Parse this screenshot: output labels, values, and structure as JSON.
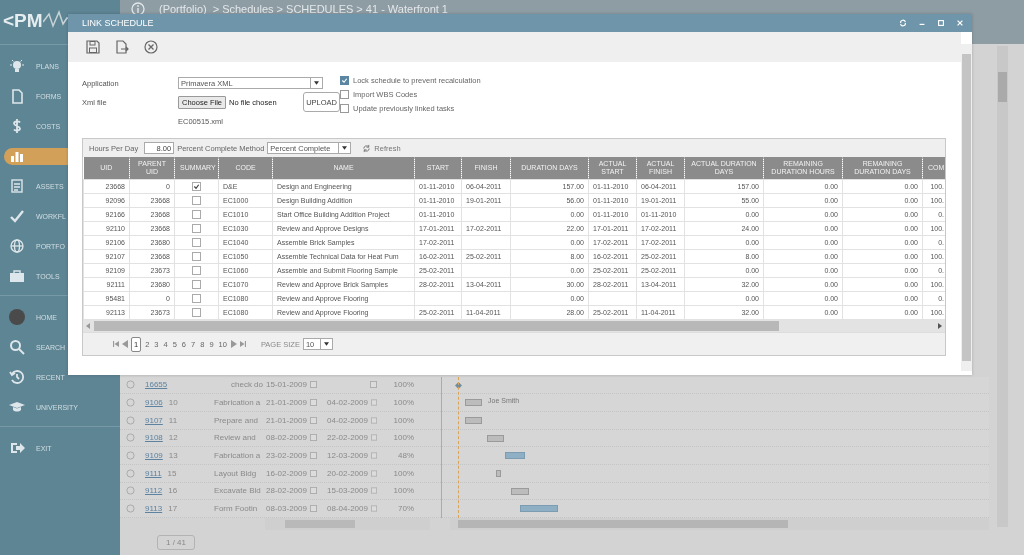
{
  "logo": {
    "text": "<PM"
  },
  "breadcrumb": {
    "link": "(Portfolio)",
    "path": "> Schedules > SCHEDULES > 41 - Waterfront 1"
  },
  "sidebar": {
    "groups": [
      {
        "items": [
          {
            "label": "PLANS",
            "selected": false
          },
          {
            "label": "FORMS",
            "selected": false
          },
          {
            "label": "COSTS",
            "selected": false
          },
          {
            "selected": true
          },
          {
            "label": "ASSETS",
            "selected": false
          },
          {
            "label": "WORKFL",
            "selected": false
          },
          {
            "label": "PORTFO",
            "selected": false
          },
          {
            "label": "TOOLS",
            "selected": false
          }
        ]
      },
      {
        "items": [
          {
            "label": "HOME",
            "selected": false
          },
          {
            "label": "SEARCH",
            "selected": false
          },
          {
            "label": "RECENT",
            "selected": false
          },
          {
            "label": "UNIVERSITY",
            "selected": false
          }
        ]
      },
      {
        "items": [
          {
            "label": "EXIT",
            "selected": false
          }
        ]
      }
    ]
  },
  "schedule": {
    "rows": [
      {
        "kind": "milestone",
        "link": "16655",
        "name": "check do",
        "start": "15-01-2009",
        "percent": "100%"
      },
      {
        "kind": "task",
        "link": "9106",
        "number": "10",
        "name": "Fabrication a",
        "start": "21-01-2009",
        "finish": "04-02-2009",
        "percent": "100%",
        "resource": "Joe Smith"
      },
      {
        "kind": "task",
        "link": "9107",
        "number": "11",
        "name": "Prepare and",
        "start": "21-01-2009",
        "finish": "04-02-2009",
        "percent": "100%"
      },
      {
        "kind": "task",
        "link": "9108",
        "number": "12",
        "name": "Review and",
        "start": "08-02-2009",
        "finish": "22-02-2009",
        "percent": "100%"
      },
      {
        "kind": "task",
        "link": "9109",
        "number": "13",
        "name": "Fabrication a",
        "start": "23-02-2009",
        "finish": "12-03-2009",
        "percent": "48%"
      },
      {
        "kind": "task",
        "link": "9111",
        "number": "15",
        "name": "Layout Bldg",
        "start": "16-02-2009",
        "finish": "20-02-2009",
        "percent": "100%"
      },
      {
        "kind": "task",
        "link": "9112",
        "number": "16",
        "name": "Excavate Bld",
        "start": "28-02-2009",
        "finish": "15-03-2009",
        "percent": "100%"
      },
      {
        "kind": "task",
        "link": "9113",
        "number": "17",
        "name": "Form Footin",
        "start": "08-03-2009",
        "finish": "08-04-2009",
        "percent": "70%"
      }
    ],
    "pager": {
      "page": "1 / 41"
    }
  },
  "dialog": {
    "title": "LINK SCHEDULE",
    "form": {
      "application_label": "Application",
      "application": "Primavera XML",
      "xml_label": "Xml file",
      "choose_button": "Choose File",
      "no_file": "No file chosen",
      "upload_button": "UPLOAD",
      "file_name": "EC00515.xml"
    },
    "options": [
      {
        "label": "Lock schedule to prevent recalculation",
        "checked": true
      },
      {
        "label": "Import WBS Codes",
        "checked": false
      },
      {
        "label": "Update previously linked tasks",
        "checked": false
      }
    ],
    "grid": {
      "hours_label": "Hours Per Day",
      "hours": "8.00",
      "method_label": "Percent Complete Method",
      "method": "Percent Complete",
      "refresh": "Refresh",
      "columns": [
        {
          "label": "UID",
          "kind": "num"
        },
        {
          "label": "PARENT UID",
          "kind": "num"
        },
        {
          "label": "SUMMARY",
          "kind": "check"
        },
        {
          "label": "CODE",
          "kind": "text"
        },
        {
          "label": "NAME",
          "kind": "text"
        },
        {
          "label": "START",
          "kind": "text"
        },
        {
          "label": "FINISH",
          "kind": "text"
        },
        {
          "label": "DURATION DAYS",
          "kind": "num"
        },
        {
          "label": "ACTUAL START",
          "kind": "text"
        },
        {
          "label": "ACTUAL FINISH",
          "kind": "text"
        },
        {
          "label": "ACTUAL DURATION DAYS",
          "kind": "num"
        },
        {
          "label": "REMAINING DURATION HOURS",
          "kind": "num"
        },
        {
          "label": "REMAINING DURATION DAYS",
          "kind": "num"
        },
        {
          "label": "COM",
          "kind": "num"
        }
      ],
      "rows": [
        {
          "uid": "23668",
          "parent_uid": "0",
          "summary": true,
          "code": "D&E",
          "name": "Design and Engineering",
          "start": "01-11-2010",
          "finish": "06-04-2011",
          "duration": "157.00",
          "actual_start": "01-11-2010",
          "actual_finish": "06-04-2011",
          "actual_duration": "157.00",
          "remaining_hours": "0.00",
          "remaining_days": "0.00",
          "complete": "100."
        },
        {
          "uid": "92096",
          "parent_uid": "23668",
          "summary": false,
          "code": "EC1000",
          "name": "Design Building Addition",
          "start": "01-11-2010",
          "finish": "19-01-2011",
          "duration": "56.00",
          "actual_start": "01-11-2010",
          "actual_finish": "19-01-2011",
          "actual_duration": "55.00",
          "remaining_hours": "0.00",
          "remaining_days": "0.00",
          "complete": "100."
        },
        {
          "uid": "92166",
          "parent_uid": "23668",
          "summary": false,
          "code": "EC1010",
          "name": "Start Office Building Addition Project",
          "start": "01-11-2010",
          "duration": "0.00",
          "actual_start": "01-11-2010",
          "actual_finish": "01-11-2010",
          "actual_duration": "0.00",
          "remaining_hours": "0.00",
          "remaining_days": "0.00",
          "complete": "0."
        },
        {
          "uid": "92110",
          "parent_uid": "23668",
          "summary": false,
          "code": "EC1030",
          "name": "Review and Approve Designs",
          "start": "17-01-2011",
          "finish": "17-02-2011",
          "duration": "22.00",
          "actual_start": "17-01-2011",
          "actual_finish": "17-02-2011",
          "actual_duration": "24.00",
          "remaining_hours": "0.00",
          "remaining_days": "0.00",
          "complete": "100."
        },
        {
          "uid": "92106",
          "parent_uid": "23680",
          "summary": false,
          "code": "EC1040",
          "name": "Assemble Brick Samples",
          "start": "17-02-2011",
          "duration": "0.00",
          "actual_start": "17-02-2011",
          "actual_finish": "17-02-2011",
          "actual_duration": "0.00",
          "remaining_hours": "0.00",
          "remaining_days": "0.00",
          "complete": "0."
        },
        {
          "uid": "92107",
          "parent_uid": "23668",
          "summary": false,
          "code": "EC1050",
          "name": "Assemble Technical Data for Heat Pum",
          "start": "16-02-2011",
          "finish": "25-02-2011",
          "duration": "8.00",
          "actual_start": "16-02-2011",
          "actual_finish": "25-02-2011",
          "actual_duration": "8.00",
          "remaining_hours": "0.00",
          "remaining_days": "0.00",
          "complete": "100."
        },
        {
          "uid": "92109",
          "parent_uid": "23673",
          "summary": false,
          "code": "EC1060",
          "name": "Assemble and Submit Flooring Sample",
          "start": "25-02-2011",
          "duration": "0.00",
          "actual_start": "25-02-2011",
          "actual_finish": "25-02-2011",
          "actual_duration": "0.00",
          "remaining_hours": "0.00",
          "remaining_days": "0.00",
          "complete": "0."
        },
        {
          "uid": "92111",
          "parent_uid": "23680",
          "summary": false,
          "code": "EC1070",
          "name": "Review and Approve Brick Samples",
          "start": "28-02-2011",
          "finish": "13-04-2011",
          "duration": "30.00",
          "actual_start": "28-02-2011",
          "actual_finish": "13-04-2011",
          "actual_duration": "32.00",
          "remaining_hours": "0.00",
          "remaining_days": "0.00",
          "complete": "100."
        },
        {
          "uid": "95481",
          "parent_uid": "0",
          "summary": false,
          "code": "EC1080",
          "name": "Review and Approve Flooring",
          "duration": "0.00",
          "actual_duration": "0.00",
          "remaining_hours": "0.00",
          "remaining_days": "0.00",
          "complete": "0."
        },
        {
          "uid": "92113",
          "parent_uid": "23673",
          "summary": false,
          "code": "EC1080",
          "name": "Review and Approve Flooring",
          "start": "25-02-2011",
          "finish": "11-04-2011",
          "duration": "28.00",
          "actual_start": "25-02-2011",
          "actual_finish": "11-04-2011",
          "actual_duration": "32.00",
          "remaining_hours": "0.00",
          "remaining_days": "0.00",
          "complete": "100."
        }
      ],
      "pages": [
        {
          "label": "1",
          "selected": true
        },
        {
          "label": "2",
          "selected": false
        },
        {
          "label": "3",
          "selected": false
        },
        {
          "label": "4",
          "selected": false
        },
        {
          "label": "5",
          "selected": false
        },
        {
          "label": "6",
          "selected": false
        },
        {
          "label": "7",
          "selected": false
        },
        {
          "label": "8",
          "selected": false
        },
        {
          "label": "9",
          "selected": false
        },
        {
          "label": "10",
          "selected": false
        }
      ],
      "page_size_label": "PAGE SIZE",
      "page_size": "10"
    }
  }
}
